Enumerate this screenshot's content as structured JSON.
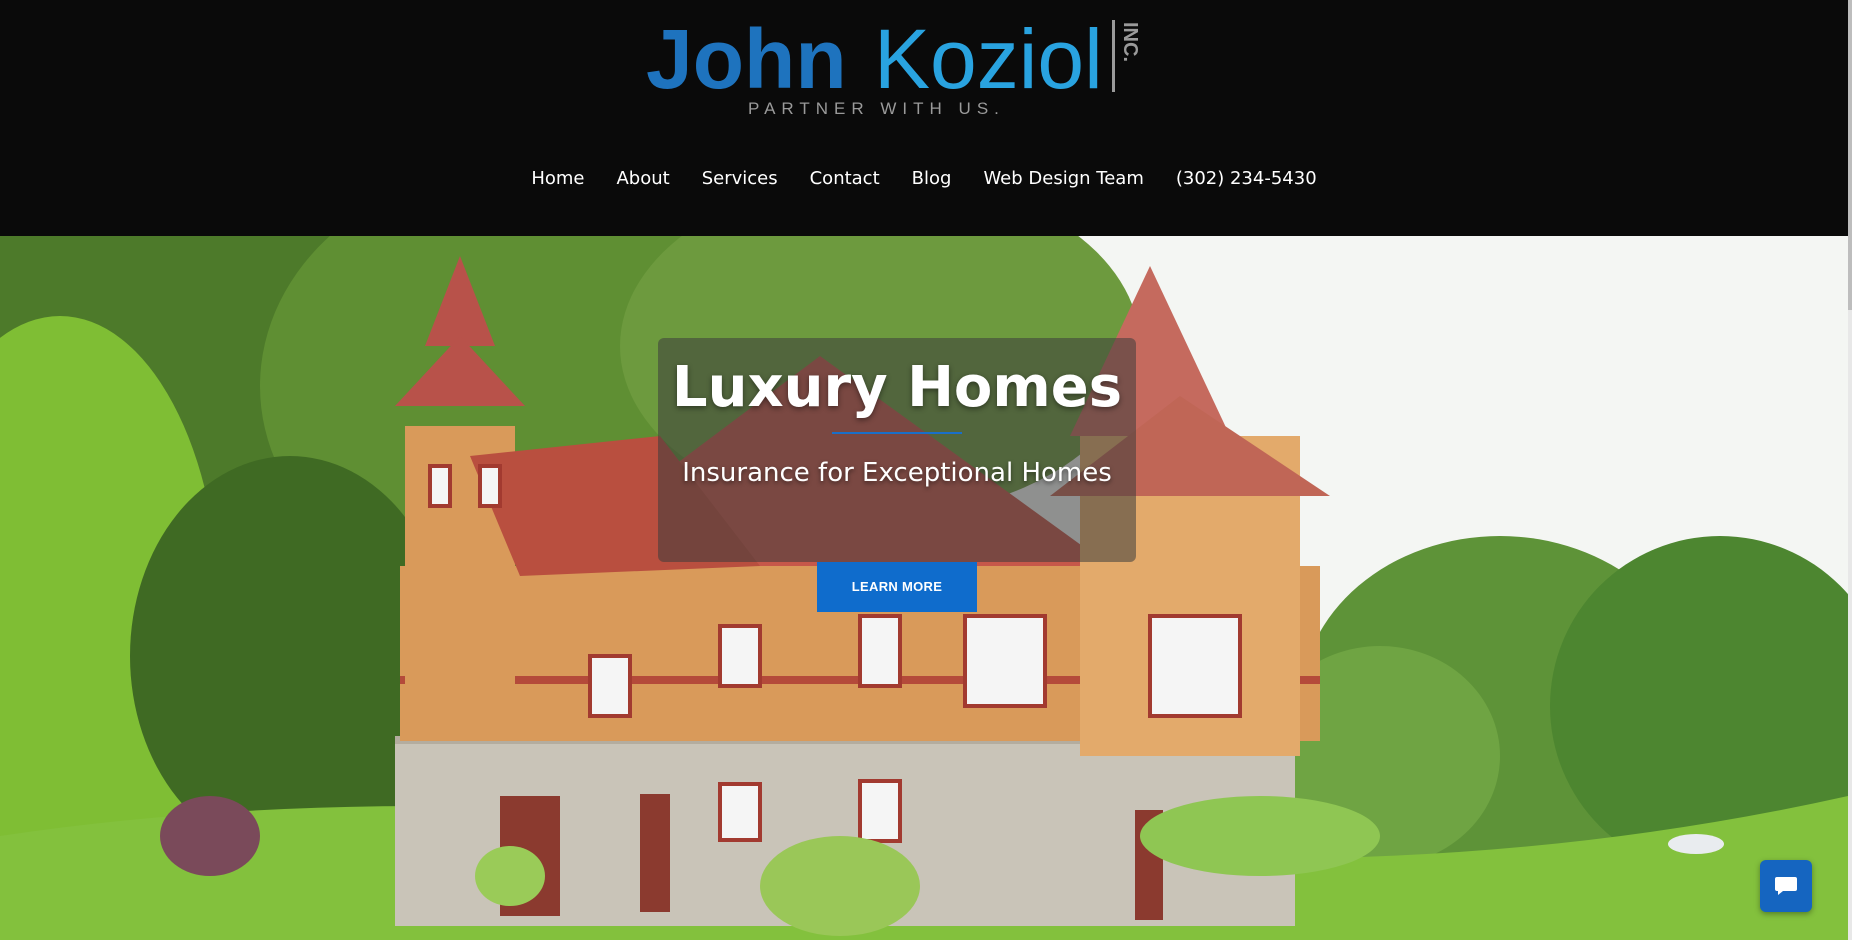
{
  "logo": {
    "brand_first": "John",
    "brand_second": "Koziol",
    "suffix": "INC.",
    "tagline": "PARTNER WITH US.",
    "colors": {
      "first": "#1e73be",
      "second": "#29a3e0",
      "tagline": "#9a9a9a"
    }
  },
  "nav": {
    "items": [
      {
        "label": "Home"
      },
      {
        "label": "About"
      },
      {
        "label": "Services"
      },
      {
        "label": "Contact"
      },
      {
        "label": "Blog"
      },
      {
        "label": "Web Design Team"
      },
      {
        "label": "(302) 234-5430"
      }
    ]
  },
  "hero": {
    "title": "Luxury Homes",
    "subtitle": "Insurance for Exceptional Homes",
    "cta_label": "LEARN MORE",
    "background_image": "victorian-house-photo"
  },
  "chat": {
    "icon": "chat-bubble-icon"
  },
  "colors": {
    "header_bg": "#0a0a0a",
    "accent": "#0f6ccc"
  }
}
